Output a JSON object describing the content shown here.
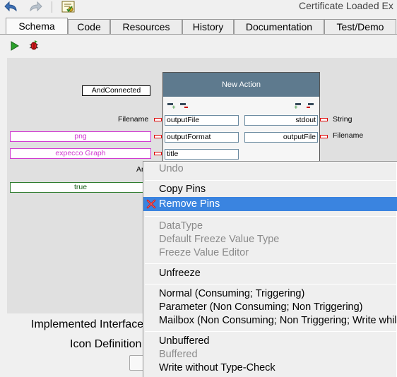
{
  "toolbar": {
    "back_icon": "undo-arrow-icon",
    "forward_icon": "redo-arrow-icon",
    "certificate_icon": "certificate-icon",
    "status_text": "Certificate Loaded  Ex"
  },
  "tabs": [
    {
      "label": "Schema",
      "active": true
    },
    {
      "label": "Code"
    },
    {
      "label": "Resources"
    },
    {
      "label": "History"
    },
    {
      "label": "Documentation"
    },
    {
      "label": "Test/Demo"
    }
  ],
  "runbar": {
    "run_icon": "play-icon",
    "debug_icon": "bug-run-icon"
  },
  "schema": {
    "and_connected": "AndConnected",
    "action_title": "New Action",
    "filename_label": "Filename",
    "string_label": "String",
    "filename_out_label": "Filename",
    "inputs": [
      "outputFile",
      "outputFormat",
      "title"
    ],
    "outputs": [
      "stdout",
      "outputFile"
    ],
    "freeze_values": [
      "png",
      "expecco Graph"
    ],
    "partial_label": "An",
    "true_value": "true",
    "colors": {
      "pink": "#d03ad0",
      "green": "#2f7d2f",
      "header": "#5e7a8e",
      "pin": "#dd0000"
    }
  },
  "below": {
    "implemented_label": "Implemented Interface",
    "icon_def_label": "Icon Definition"
  },
  "context_menu": {
    "undo": "Undo",
    "copy_pins": "Copy Pins",
    "remove_pins": "Remove Pins",
    "data_type": "DataType",
    "default_freeze": "Default Freeze Value Type",
    "freeze_editor": "Freeze Value Editor",
    "unfreeze": "Unfreeze",
    "normal": "Normal (Consuming; Triggering)",
    "parameter": "Parameter (Non Consuming; Non Triggering)",
    "mailbox": "Mailbox (Non Consuming; Non Triggering; Write whil",
    "unbuffered": "Unbuffered",
    "buffered": "Buffered",
    "write_without": "Write without Type-Check",
    "highlight_color": "#3a84e0"
  }
}
